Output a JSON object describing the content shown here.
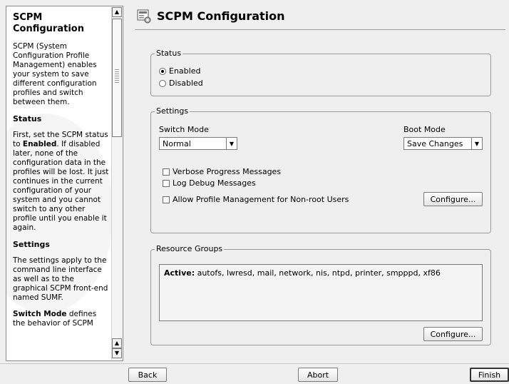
{
  "help": {
    "title": "SCPM Configuration",
    "intro": "SCPM (System Configuration Profile Management) enables your system to save different configuration profiles and switch between them.",
    "status_heading": "Status",
    "status_text_a": "First, set the SCPM status to ",
    "status_text_bold": "Enabled",
    "status_text_b": ". If disabled later, none of the configuration data in the profiles will be lost. It just continues in the current configuration of your system and you cannot switch to any other profile until you enable it again.",
    "settings_heading": "Settings",
    "settings_text": "The settings apply to the command line interface as well as to the graphical SCPM front-end named SUMF.",
    "switch_bold": "Switch Mode",
    "switch_text": " defines the behavior of SCPM"
  },
  "header": {
    "title": "SCPM Configuration",
    "icon": "config-icon"
  },
  "status": {
    "label": "Status",
    "enabled": {
      "label": "Enabled",
      "checked": true
    },
    "disabled": {
      "label": "Disabled",
      "checked": false
    }
  },
  "settings": {
    "label": "Settings",
    "switch_mode_label": "Switch Mode",
    "switch_mode_value": "Normal",
    "boot_mode_label": "Boot Mode",
    "boot_mode_value": "Save Changes",
    "verbose_label": "Verbose Progress Messages",
    "log_debug_label": "Log Debug Messages",
    "allow_profile_label": "Allow Profile Management for Non-root Users",
    "configure_label": "Configure..."
  },
  "resource_groups": {
    "label": "Resource Groups",
    "active_label": "Active:",
    "active_list": " autofs, lwresd, mail, network, nis, ntpd, printer, smpppd, xf86",
    "configure_label": "Configure..."
  },
  "footer": {
    "back": "Back",
    "abort": "Abort",
    "finish": "Finish"
  }
}
